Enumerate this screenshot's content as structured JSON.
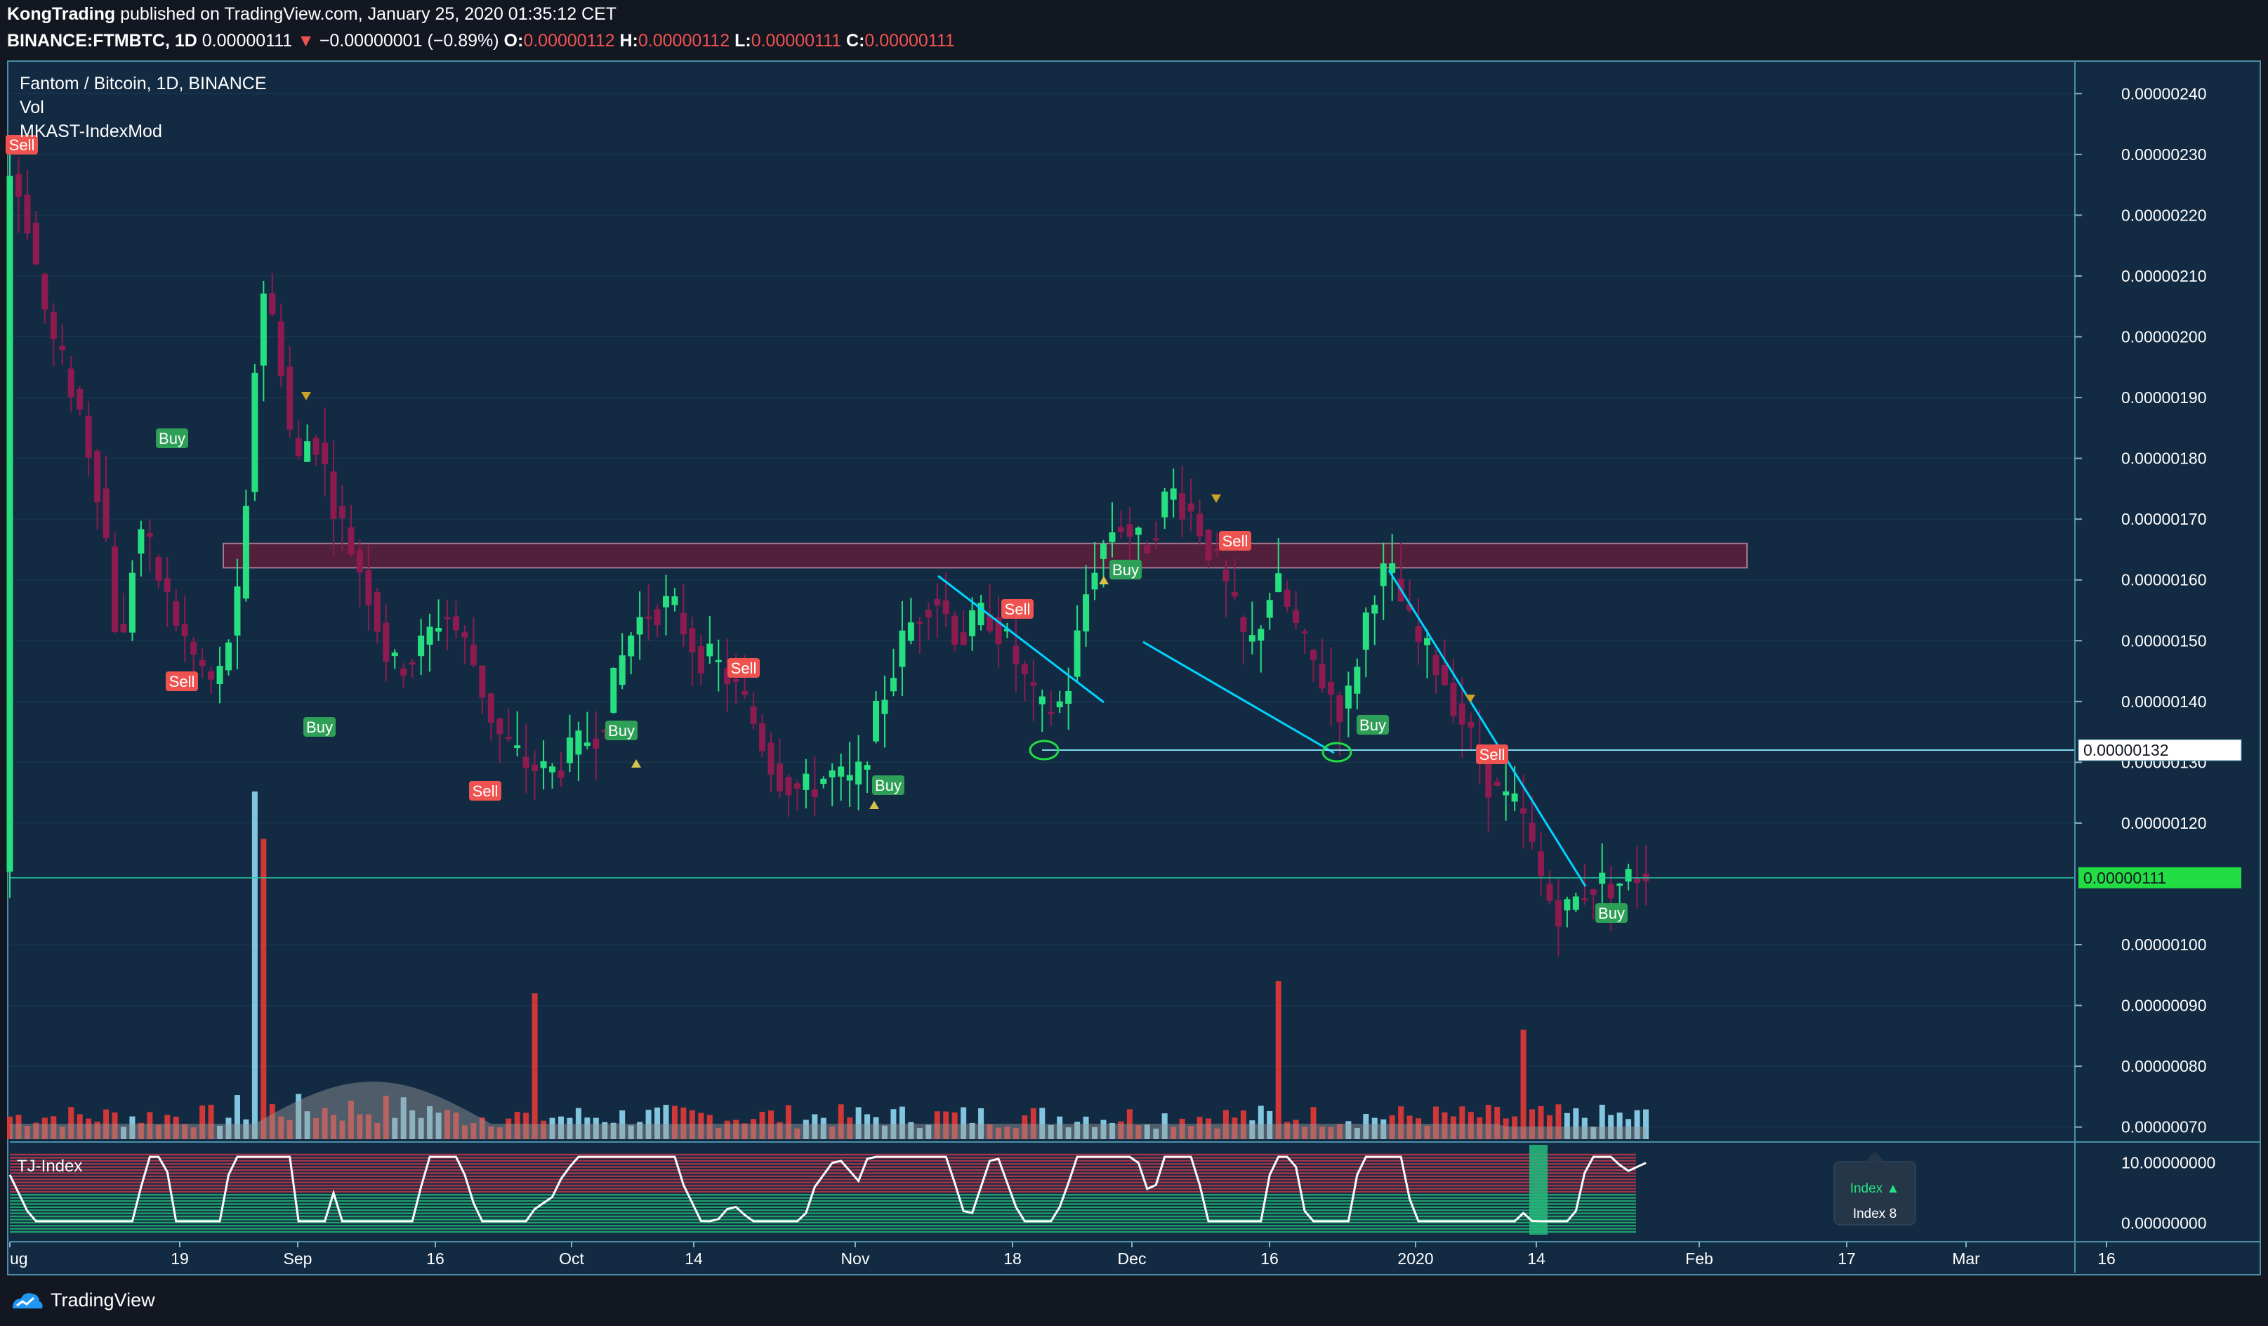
{
  "header": {
    "author": "KongTrading",
    "published_text": " published on TradingView.com, January 25, 2020 01:35:12 CET",
    "symbol": "BINANCE:FTMBTC, 1D",
    "last": "0.00000111",
    "change_icon": "triangle-down-icon",
    "change": "−0.00000001 (−0.89%)",
    "o_label": "O:",
    "o": "0.00000112",
    "h_label": "H:",
    "h": "0.00000112",
    "l_label": "L:",
    "l": "0.00000111",
    "c_label": "C:",
    "c": "0.00000111"
  },
  "legend": {
    "title": "Fantom / Bitcoin, 1D, BINANCE",
    "vol": "Vol",
    "indicator": "MKAST-IndexMod",
    "oscillator": "TJ-Index"
  },
  "price_axis": {
    "ticks": [
      "0.00000240",
      "0.00000230",
      "0.00000220",
      "0.00000210",
      "0.00000200",
      "0.00000190",
      "0.00000180",
      "0.00000170",
      "0.00000160",
      "0.00000150",
      "0.00000140",
      "0.00000130",
      "0.00000120",
      "0.00000100",
      "0.00000090",
      "0.00000080",
      "0.00000070"
    ],
    "highlight_level": "0.00000132",
    "current_price": "0.00000111"
  },
  "osc_axis": {
    "ticks": [
      "10.00000000",
      "0.00000000"
    ]
  },
  "time_axis": {
    "ticks": [
      "ug",
      "19",
      "Sep",
      "16",
      "Oct",
      "14",
      "Nov",
      "18",
      "Dec",
      "16",
      "2020",
      "14",
      "Feb",
      "17",
      "Mar",
      "16"
    ]
  },
  "signals": [
    "Sell",
    "Buy",
    "Sell",
    "Buy",
    "Sell",
    "Buy",
    "Sell",
    "Buy",
    "Sell",
    "Buy",
    "Sell",
    "Buy",
    "Sell",
    "Buy"
  ],
  "index_box": {
    "line1": "Index ▲",
    "line2": "Index 8"
  },
  "footer": {
    "brand": "TradingView",
    "logo_icon": "tradingview-logo-icon"
  },
  "colors": {
    "background": "#132a43",
    "up": "#26e07f",
    "down": "#8e1b4f",
    "trendline": "#00d4ff",
    "zone": "#5e1e3a",
    "vol_up": "#8fd6f0",
    "vol_down": "#e53935"
  },
  "chart_data": {
    "type": "candlestick",
    "title": "Fantom / Bitcoin, 1D, BINANCE",
    "ylim": [
      6.8e-07,
      2.45e-06
    ],
    "x_ticks": [
      "ug",
      "19",
      "Sep",
      "16",
      "Oct",
      "14",
      "Nov",
      "18",
      "Dec",
      "16",
      "2020",
      "14",
      "Feb",
      "17",
      "Mar",
      "16"
    ],
    "close_anchors": [
      [
        0,
        2.28e-06
      ],
      [
        2,
        2.22e-06
      ],
      [
        5,
        2e-06
      ],
      [
        8,
        1.9e-06
      ],
      [
        11,
        1.72e-06
      ],
      [
        13,
        1.45e-06
      ],
      [
        15,
        1.7e-06
      ],
      [
        18,
        1.58e-06
      ],
      [
        21,
        1.48e-06
      ],
      [
        24,
        1.42e-06
      ],
      [
        27,
        1.6e-06
      ],
      [
        29,
        2.1e-06
      ],
      [
        31,
        2e-06
      ],
      [
        33,
        1.78e-06
      ],
      [
        35,
        1.85e-06
      ],
      [
        38,
        1.7e-06
      ],
      [
        41,
        1.6e-06
      ],
      [
        44,
        1.45e-06
      ],
      [
        47,
        1.48e-06
      ],
      [
        50,
        1.55e-06
      ],
      [
        53,
        1.48e-06
      ],
      [
        56,
        1.35e-06
      ],
      [
        59,
        1.3e-06
      ],
      [
        62,
        1.28e-06
      ],
      [
        65,
        1.32e-06
      ],
      [
        68,
        1.36e-06
      ],
      [
        71,
        1.5e-06
      ],
      [
        73,
        1.55e-06
      ],
      [
        76,
        1.56e-06
      ],
      [
        79,
        1.48e-06
      ],
      [
        82,
        1.45e-06
      ],
      [
        85,
        1.38e-06
      ],
      [
        88,
        1.28e-06
      ],
      [
        91,
        1.25e-06
      ],
      [
        94,
        1.28e-06
      ],
      [
        97,
        1.26e-06
      ],
      [
        100,
        1.4e-06
      ],
      [
        103,
        1.52e-06
      ],
      [
        106,
        1.58e-06
      ],
      [
        109,
        1.5e-06
      ],
      [
        112,
        1.55e-06
      ],
      [
        115,
        1.48e-06
      ],
      [
        118,
        1.38e-06
      ],
      [
        121,
        1.4e-06
      ],
      [
        124,
        1.62e-06
      ],
      [
        127,
        1.7e-06
      ],
      [
        130,
        1.65e-06
      ],
      [
        133,
        1.75e-06
      ],
      [
        136,
        1.7e-06
      ],
      [
        139,
        1.6e-06
      ],
      [
        142,
        1.48e-06
      ],
      [
        145,
        1.6e-06
      ],
      [
        148,
        1.5e-06
      ],
      [
        151,
        1.42e-06
      ],
      [
        153,
        1.38e-06
      ],
      [
        156,
        1.58e-06
      ],
      [
        158,
        1.62e-06
      ],
      [
        161,
        1.5e-06
      ],
      [
        164,
        1.45e-06
      ],
      [
        167,
        1.35e-06
      ],
      [
        170,
        1.25e-06
      ],
      [
        173,
        1.22e-06
      ],
      [
        176,
        1.08e-06
      ],
      [
        178,
        1.05e-06
      ],
      [
        181,
        1.1e-06
      ],
      [
        184,
        1.1e-06
      ],
      [
        187,
        1.12e-06
      ]
    ],
    "volume_peaks": [
      [
        28,
        1.12e-06
      ],
      [
        29,
        1.06e-06
      ],
      [
        60,
        9.2e-07
      ],
      [
        145,
        9.4e-07
      ],
      [
        173,
        8.6e-07
      ]
    ],
    "resistance_zone": [
      1.62e-06,
      1.66e-06
    ],
    "support_level": 1.32e-06,
    "current_price": 1.11e-06,
    "oscillator": {
      "name": "TJ-Index",
      "ylim": [
        -1,
        13
      ],
      "ticks": [
        10,
        0
      ]
    }
  }
}
